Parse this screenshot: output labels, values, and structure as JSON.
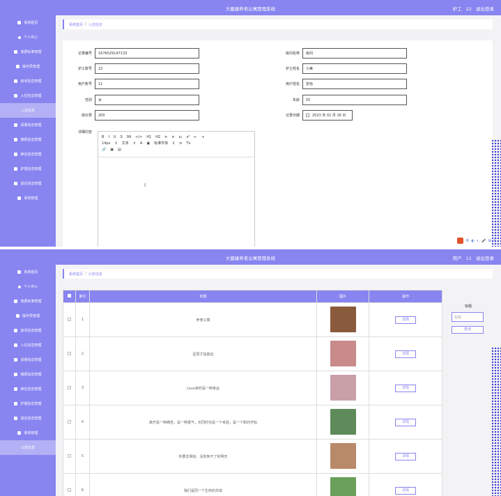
{
  "app": {
    "title": "大健康养老公寓管理系统"
  },
  "top_panel": {
    "user_role": "护工",
    "user_name": "22",
    "logout_label": "退出登录",
    "sidebar": [
      {
        "label": "系统首页",
        "active": false
      },
      {
        "label": "个人中心",
        "active": false
      },
      {
        "label": "收费标准管理",
        "active": false
      },
      {
        "label": "操作员管理",
        "active": false
      },
      {
        "label": "房间信息管理",
        "active": false
      },
      {
        "label": "入住信息管理",
        "active": false
      },
      {
        "label": "入住信息",
        "active": true
      },
      {
        "label": "请假信息管理",
        "active": false
      },
      {
        "label": "缴费信息管理",
        "active": false
      },
      {
        "label": "续住信息管理",
        "active": false
      },
      {
        "label": "护理信息管理",
        "active": false
      },
      {
        "label": "退住信息管理",
        "active": false
      },
      {
        "label": "系统管理",
        "active": false
      }
    ],
    "breadcrumb": {
      "home": "系统首页",
      "current": "入住信息"
    },
    "form": {
      "record_no": {
        "label": "记录编号",
        "value": "1676529147133"
      },
      "room_name": {
        "label": "房间名称",
        "value": "房间"
      },
      "worker_account": {
        "label": "护工账号",
        "value": "22"
      },
      "worker_name": {
        "label": "护士姓名",
        "value": "小美"
      },
      "user_account": {
        "label": "用户账号",
        "value": "11"
      },
      "user_name": {
        "label": "用户姓名",
        "value": "张怡"
      },
      "gender": {
        "label": "性别",
        "value": "女"
      },
      "age": {
        "label": "年龄",
        "value": "55"
      },
      "fee": {
        "label": "房价费",
        "value": "200"
      },
      "register_date": {
        "label": "记录日期",
        "value": "2023 年 02 月 16 日"
      },
      "detail_label": "详细内容"
    },
    "editor": {
      "toolbar_row1": [
        "B",
        "I",
        "U",
        "S",
        "99",
        "</>",
        "H1",
        "H2",
        "≡",
        "≡",
        "x₂",
        "x²",
        "⇤",
        "⇥"
      ],
      "toolbar_row2": [
        "14px",
        "⇕",
        "文本",
        "⇕",
        "A",
        "▣",
        "标准字体",
        "⇕",
        "≡",
        "Tx"
      ],
      "toolbar_row3": [
        "🔗",
        "▣",
        "▤"
      ]
    },
    "ime_labels": [
      "中",
      "◐",
      "•,",
      "🎤",
      "⊞",
      "⇩"
    ]
  },
  "bottom_panel": {
    "user_role": "用户",
    "user_name": "11",
    "logout_label": "退出登录",
    "sidebar": [
      {
        "label": "系统首页",
        "active": false
      },
      {
        "label": "个人中心",
        "active": false
      },
      {
        "label": "收费标准管理",
        "active": false
      },
      {
        "label": "操作员管理",
        "active": false
      },
      {
        "label": "房间信息管理",
        "active": false
      },
      {
        "label": "入住信息管理",
        "active": false
      },
      {
        "label": "请假信息管理",
        "active": false
      },
      {
        "label": "缴费信息管理",
        "active": false
      },
      {
        "label": "续住信息管理",
        "active": false
      },
      {
        "label": "护理信息管理",
        "active": false
      },
      {
        "label": "退住信息管理",
        "active": false
      },
      {
        "label": "系统管理",
        "active": false
      },
      {
        "label": "公告信息",
        "active": true
      }
    ],
    "breadcrumb": {
      "home": "系统首页",
      "current": "公告信息"
    },
    "table": {
      "headers": [
        "",
        "索引",
        "标题",
        "图片",
        "操作"
      ],
      "detail_label": "详情",
      "rows": [
        {
          "index": "1",
          "title": "养老公寓",
          "thumb_color": "#8a5a3c"
        },
        {
          "index": "2",
          "title": "星辰才是最远",
          "thumb_color": "#c98a8a"
        },
        {
          "index": "3",
          "title": "Love来时是一种幸运",
          "thumb_color": "#c9a0a8"
        },
        {
          "index": "4",
          "title": "离开是一种痛苦，是一种勇气，也同时也是一个考验，是一个新的开始",
          "thumb_color": "#5f8a5a"
        },
        {
          "index": "5",
          "title": "你要去相信，没有到不了的明天",
          "thumb_color": "#b98a6a"
        },
        {
          "index": "6",
          "title": "我们是同一个生命的共体",
          "thumb_color": "#6aa05a"
        }
      ]
    },
    "filter": {
      "label": "标题",
      "placeholder": "标题",
      "search_label": "查询"
    }
  }
}
